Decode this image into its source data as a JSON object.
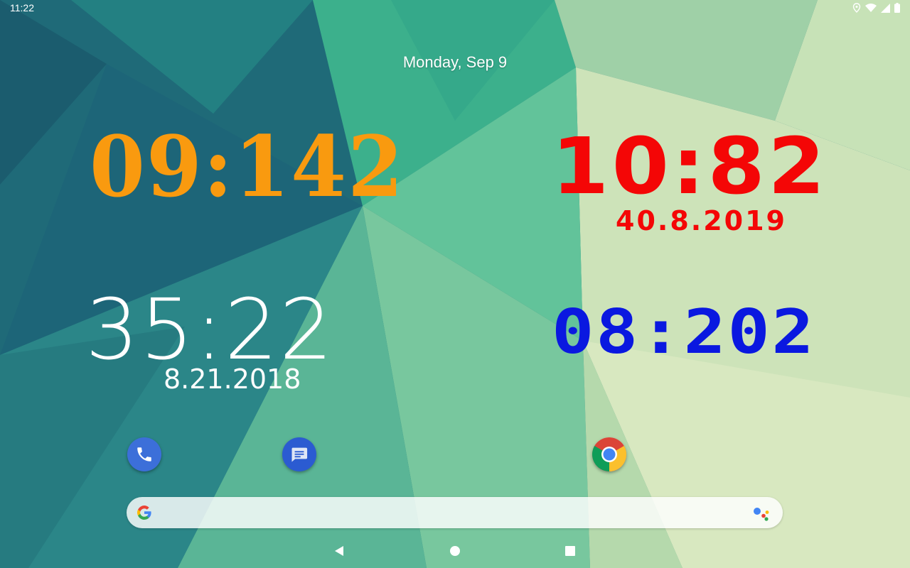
{
  "status_bar": {
    "time": "11:22",
    "icons": [
      "location-icon",
      "wifi-icon",
      "signal-icon",
      "battery-icon"
    ]
  },
  "home": {
    "date_label": "Monday, Sep 9"
  },
  "widgets": {
    "clock_orange": {
      "time": "09:142",
      "color": "#f99a0f"
    },
    "clock_red": {
      "time": "10:82",
      "date": "40.8.2019",
      "color": "#f40606"
    },
    "clock_white": {
      "time": "35:22",
      "date": "8.21.2018",
      "color": "#ffffff"
    },
    "clock_blue": {
      "time": "08:202",
      "color": "#0a18e0"
    }
  },
  "dock": {
    "apps": [
      "phone-icon",
      "messages-icon",
      "chrome-icon"
    ]
  },
  "search": {
    "logo": "google-icon",
    "assistant": "assistant-icon"
  },
  "nav": {
    "buttons": [
      "back-icon",
      "home-icon",
      "recents-icon"
    ]
  }
}
